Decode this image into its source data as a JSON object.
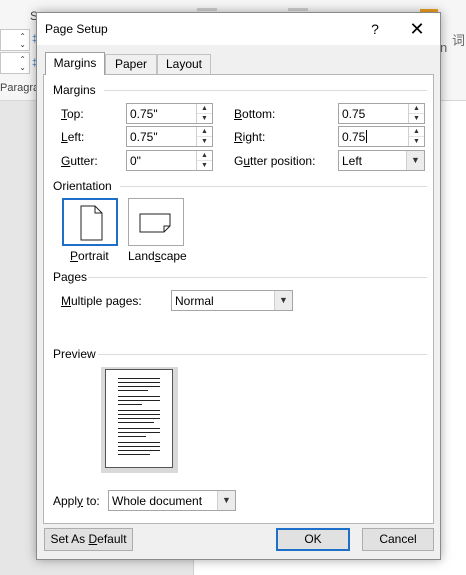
{
  "background": {
    "left_column_fragment": "Paragra",
    "top_fragment": "S",
    "right_fragment_1": "n",
    "right_fragment_2": "词"
  },
  "dialog": {
    "title": "Page Setup",
    "help_glyph": "?",
    "close_glyph": "✕"
  },
  "tabs": [
    {
      "label": "Margins"
    },
    {
      "label": "Paper"
    },
    {
      "label": "Layout"
    }
  ],
  "margins": {
    "section_label": "Margins",
    "top": {
      "label_key": "T",
      "label_rest": "op:",
      "value": "0.75\""
    },
    "bottom": {
      "label_key": "B",
      "label_rest": "ottom:",
      "value": "0.75"
    },
    "left": {
      "label_key": "L",
      "label_rest": "eft:",
      "value": "0.75\""
    },
    "right": {
      "label_key": "R",
      "label_rest": "ight:",
      "value": "0.75"
    },
    "gutter": {
      "label_key": "G",
      "label_rest": "utter:",
      "value": "0\""
    },
    "gutter_position": {
      "label_pre": "G",
      "label_key": "u",
      "label_rest": "tter position:",
      "value": "Left"
    }
  },
  "orientation": {
    "section_label": "Orientation",
    "portrait": {
      "label_key": "P",
      "label_rest": "ortrait"
    },
    "landscape": {
      "label_key": "s",
      "label_pre": "Land",
      "label_rest": "cape"
    }
  },
  "pages": {
    "section_label": "Pages",
    "multiple_label_key": "M",
    "multiple_label_rest": "ultiple pages:",
    "multiple_value": "Normal"
  },
  "preview": {
    "section_label": "Preview"
  },
  "apply_to": {
    "label_pre": "Appl",
    "label_key": "y",
    "label_rest": " to:",
    "value": "Whole document"
  },
  "buttons": {
    "set_default_pre": "Set As ",
    "set_default_key": "D",
    "set_default_rest": "efault",
    "ok": "OK",
    "cancel": "Cancel"
  },
  "colors": {
    "accent": "#1e6fc8",
    "dialog_bg": "#f0f0f0",
    "panel_bg": "#ffffff"
  }
}
